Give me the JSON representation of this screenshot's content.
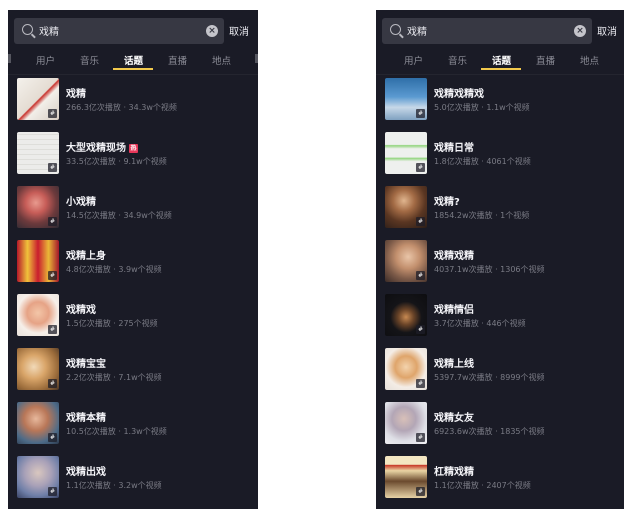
{
  "left_panel": {
    "search": {
      "query": "戏精",
      "cancel_label": "取消"
    },
    "tabs": [
      "用户",
      "音乐",
      "话题",
      "直播",
      "地点"
    ],
    "active_tab": "话题",
    "items": [
      {
        "title": "戏精",
        "meta": "266.3亿次播放 · 34.3w个视频",
        "hot": false
      },
      {
        "title": "大型戏精现场",
        "meta": "33.5亿次播放 · 9.1w个视频",
        "hot": true
      },
      {
        "title": "小戏精",
        "meta": "14.5亿次播放 · 34.9w个视频",
        "hot": false
      },
      {
        "title": "戏精上身",
        "meta": "4.8亿次播放 · 3.9w个视频",
        "hot": false
      },
      {
        "title": "戏精戏",
        "meta": "1.5亿次播放 · 275个视频",
        "hot": false
      },
      {
        "title": "戏精宝宝",
        "meta": "2.2亿次播放 · 7.1w个视频",
        "hot": false
      },
      {
        "title": "戏精本精",
        "meta": "10.5亿次播放 · 1.3w个视频",
        "hot": false
      },
      {
        "title": "戏精出戏",
        "meta": "1.1亿次播放 · 3.2w个视频",
        "hot": false
      }
    ]
  },
  "right_panel": {
    "search": {
      "query": "戏精",
      "cancel_label": "取消"
    },
    "tabs": [
      "用户",
      "音乐",
      "话题",
      "直播",
      "地点"
    ],
    "active_tab": "话题",
    "items": [
      {
        "title": "戏精戏精戏",
        "meta": "5.0亿次播放 · 1.1w个视频",
        "hot": false
      },
      {
        "title": "戏精日常",
        "meta": "1.8亿次播放 · 4061个视频",
        "hot": false
      },
      {
        "title": "戏精?",
        "meta": "1854.2w次播放 · 1个视频",
        "hot": false
      },
      {
        "title": "戏精戏精",
        "meta": "4037.1w次播放 · 1306个视频",
        "hot": false
      },
      {
        "title": "戏精情侣",
        "meta": "3.7亿次播放 · 446个视频",
        "hot": false
      },
      {
        "title": "戏精上线",
        "meta": "5397.7w次播放 · 8999个视频",
        "hot": false
      },
      {
        "title": "戏精女友",
        "meta": "6923.6w次播放 · 1835个视频",
        "hot": false
      },
      {
        "title": "杠精戏精",
        "meta": "1.1亿次播放 · 2407个视频",
        "hot": false
      }
    ]
  },
  "hot_badge_label": "热",
  "topic_badge_icon": "hashtag-icon",
  "colors": {
    "background": "#1a1b26",
    "accent": "#f2c94c",
    "hot": "#e8375a"
  }
}
